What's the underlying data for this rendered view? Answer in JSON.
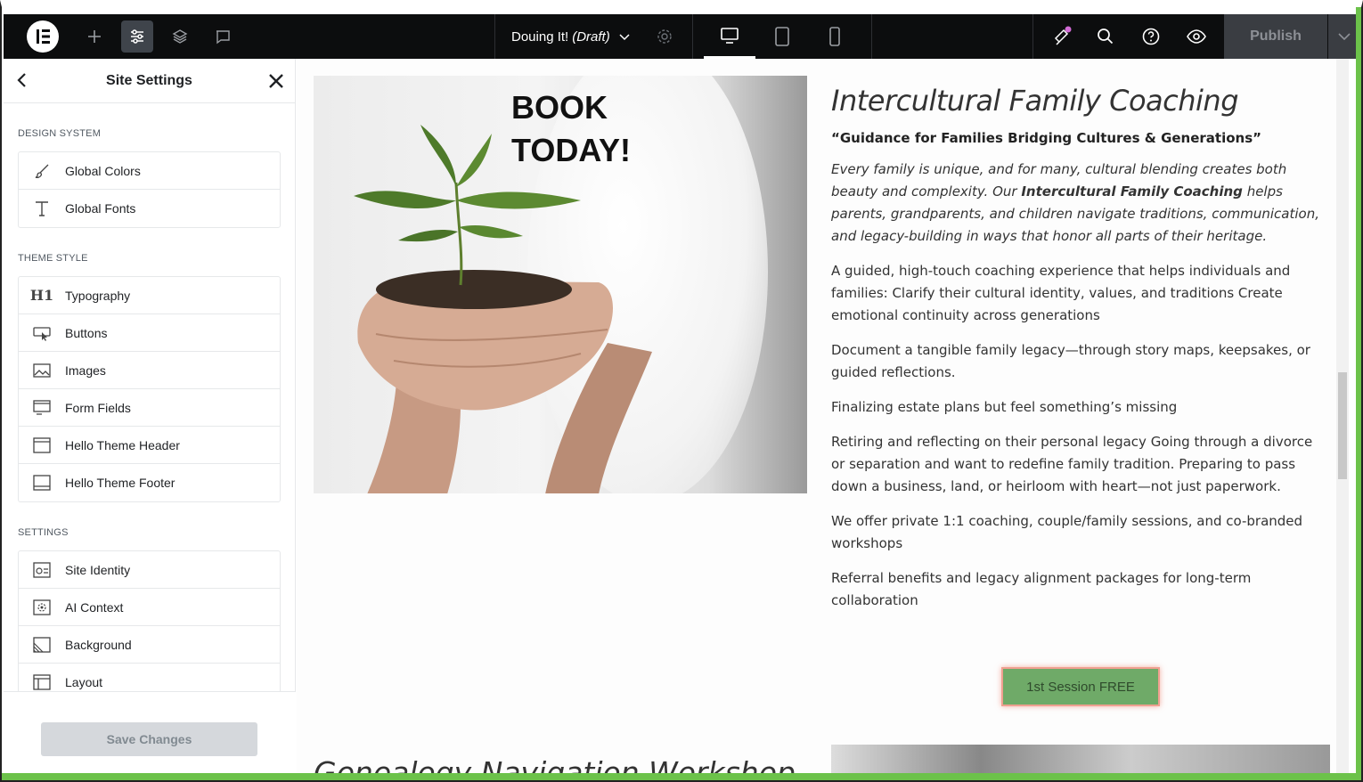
{
  "topbar": {
    "doc_title": "Douing It!",
    "doc_status": "(Draft)",
    "publish_label": "Publish"
  },
  "panel": {
    "title": "Site Settings",
    "sections": [
      {
        "label": "DESIGN SYSTEM",
        "items": [
          {
            "label": "Global Colors",
            "icon": "brush-icon"
          },
          {
            "label": "Global Fonts",
            "icon": "font-icon"
          }
        ]
      },
      {
        "label": "THEME STYLE",
        "items": [
          {
            "label": "Typography",
            "icon": "heading-icon"
          },
          {
            "label": "Buttons",
            "icon": "button-icon"
          },
          {
            "label": "Images",
            "icon": "image-icon"
          },
          {
            "label": "Form Fields",
            "icon": "form-icon"
          },
          {
            "label": "Hello Theme Header",
            "icon": "header-icon"
          },
          {
            "label": "Hello Theme Footer",
            "icon": "footer-icon"
          }
        ]
      },
      {
        "label": "SETTINGS",
        "items": [
          {
            "label": "Site Identity",
            "icon": "identity-icon"
          },
          {
            "label": "AI Context",
            "icon": "ai-icon"
          },
          {
            "label": "Background",
            "icon": "background-icon"
          },
          {
            "label": "Layout",
            "icon": "layout-icon"
          }
        ]
      }
    ],
    "save_label": "Save Changes"
  },
  "page": {
    "book_line1": "BOOK",
    "book_line2": "TODAY!",
    "title": "Intercultural Family Coaching",
    "subtitle": "“Guidance for Families Bridging Cultures & Generations”",
    "intro_a": "Every family is unique, and for many, cultural blending creates both beauty and complexity. Our ",
    "intro_bold": "Intercultural Family Coaching",
    "intro_b": " helps parents, grandparents, and children navigate traditions, communication, and legacy-building in ways that honor all parts of their heritage.",
    "p1": "A guided, high-touch coaching experience that helps individuals and families: Clarify their cultural identity, values, and traditions Create emotional continuity across generations",
    "p2": "Document a tangible family legacy—through story maps, keepsakes, or guided reflections.",
    "p3": "Finalizing estate plans but feel something’s missing",
    "p4": "Retiring and reflecting on their personal legacy Going through a divorce or separation and want to redefine family tradition. Preparing to pass down a business, land, or heirloom with heart—not just paperwork.",
    "p5": "We offer private 1:1 coaching, couple/family sessions, and co-branded workshops",
    "p6": "Referral benefits and legacy alignment packages for long-term collaboration",
    "cta_label": "1st Session FREE",
    "next_heading": "Genealogy Navigation Workshop"
  }
}
